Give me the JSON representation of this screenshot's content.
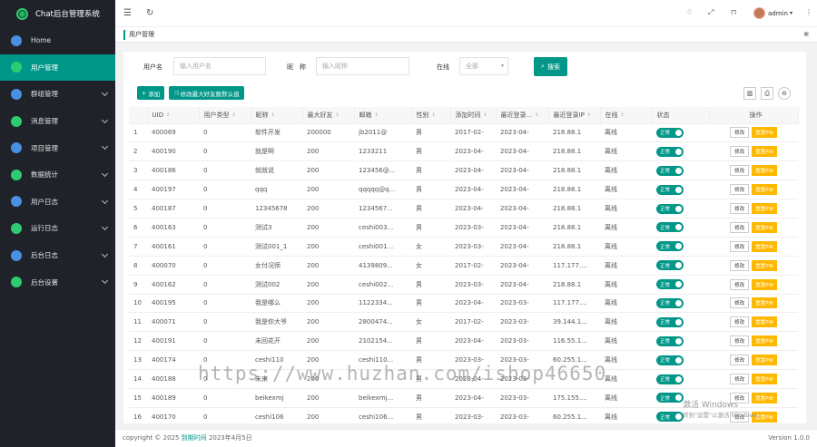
{
  "app": {
    "title": "Chat后台管理系统"
  },
  "sidebar": {
    "items": [
      {
        "label": "Home",
        "color": "#4a90e2",
        "active": false,
        "caret": false
      },
      {
        "label": "用户管理",
        "color": "#2ecc71",
        "active": true,
        "caret": false
      },
      {
        "label": "群组管理",
        "color": "#4a90e2",
        "active": false,
        "caret": true
      },
      {
        "label": "消息管理",
        "color": "#2ecc71",
        "active": false,
        "caret": true
      },
      {
        "label": "项目管理",
        "color": "#4a90e2",
        "active": false,
        "caret": true
      },
      {
        "label": "数据统计",
        "color": "#2ecc71",
        "active": false,
        "caret": true
      },
      {
        "label": "用户日志",
        "color": "#4a90e2",
        "active": false,
        "caret": true
      },
      {
        "label": "运行日志",
        "color": "#2ecc71",
        "active": false,
        "caret": true
      },
      {
        "label": "后台日志",
        "color": "#4a90e2",
        "active": false,
        "caret": true
      },
      {
        "label": "后台设置",
        "color": "#2ecc71",
        "active": false,
        "caret": true
      }
    ]
  },
  "topbar": {
    "user": "admin"
  },
  "tabs": {
    "current": "用户管理"
  },
  "search": {
    "user_label": "用户名",
    "user_placeholder": "输入用户名",
    "nick_label": "昵　称",
    "nick_placeholder": "输入昵称",
    "online_label": "在线",
    "online_value": "全部",
    "button": "搜索"
  },
  "toolbar": {
    "add": "添加",
    "batch": "修改最大好友数默认值"
  },
  "table": {
    "headers": [
      "",
      "UID",
      "用户类型",
      "昵称",
      "最大好友",
      "邮箱",
      "性别",
      "添加时间",
      "最近登录...",
      "最近登录IP",
      "在线",
      "状态",
      "操作"
    ],
    "status_label": "正常",
    "edit_label": "修改",
    "pwd_label": "重置PW",
    "rows": [
      [
        "1",
        "400069",
        "0",
        "软件开发",
        "200000",
        "jb2011@",
        "男",
        "2017-02-",
        "2023-04-",
        "218.88.1",
        "离线"
      ],
      [
        "2",
        "400190",
        "0",
        "就是啊",
        "200",
        "1233211",
        "男",
        "2023-04-",
        "2023-04-",
        "218.88.1",
        "离线"
      ],
      [
        "3",
        "400186",
        "0",
        "就就说",
        "200",
        "123456@...",
        "男",
        "2023-04-",
        "2023-04-",
        "218.88.1",
        "离线"
      ],
      [
        "4",
        "400197",
        "0",
        "qqq",
        "200",
        "qqqqq@q...",
        "男",
        "2023-04-",
        "2023-04-",
        "218.88.1",
        "离线"
      ],
      [
        "5",
        "400187",
        "0",
        "12345678",
        "200",
        "1234567...",
        "男",
        "2023-04-",
        "2023-04-",
        "218.88.1",
        "离线"
      ],
      [
        "6",
        "400163",
        "0",
        "测试3",
        "200",
        "ceshi003...",
        "男",
        "2023-03-",
        "2023-04-",
        "218.88.1",
        "离线"
      ],
      [
        "7",
        "400161",
        "0",
        "测试001_1",
        "200",
        "ceshi001...",
        "女",
        "2023-03-",
        "2023-04-",
        "218.88.1",
        "离线"
      ],
      [
        "8",
        "400070",
        "0",
        "女付况师",
        "200",
        "4139809...",
        "女",
        "2017-02-",
        "2023-04-",
        "117.177....",
        "离线"
      ],
      [
        "9",
        "400162",
        "0",
        "测试002",
        "200",
        "ceshi002...",
        "男",
        "2023-03-",
        "2023-04-",
        "218.88.1",
        "离线"
      ],
      [
        "10",
        "400195",
        "0",
        "我是哪么",
        "200",
        "1122334...",
        "男",
        "2023-04-",
        "2023-03-",
        "117.177....",
        "离线"
      ],
      [
        "11",
        "400071",
        "0",
        "我是你大爷",
        "200",
        "2800474...",
        "女",
        "2017-02-",
        "2023-03-",
        "39.144.1...",
        "离线"
      ],
      [
        "12",
        "400191",
        "0",
        "未回花开",
        "200",
        "2102154...",
        "男",
        "2023-04-",
        "2023-03-",
        "116.55.1...",
        "离线"
      ],
      [
        "13",
        "400174",
        "0",
        "ceshi110",
        "200",
        "ceshi110...",
        "男",
        "2023-03-",
        "2023-03-",
        "60.255.1...",
        "离线"
      ],
      [
        "14",
        "400188",
        "0",
        "未来",
        "200",
        "",
        "男",
        "2023-04-",
        "2023-03-",
        "",
        "离线"
      ],
      [
        "15",
        "400189",
        "0",
        "beikexmj",
        "200",
        "beikexmj...",
        "男",
        "2023-04-",
        "2023-03-",
        "175.155....",
        "离线"
      ],
      [
        "16",
        "400170",
        "0",
        "ceshi106",
        "200",
        "ceshi106...",
        "男",
        "2023-03-",
        "2023-03-",
        "60.255.1...",
        "离线"
      ]
    ]
  },
  "footer": {
    "copyright": "copyright © 2025",
    "link": "到期时间",
    "date": "2023年4月5日",
    "version": "Version 1.0.0"
  },
  "watermark": "https://www.huzhan.com/ishop46650",
  "windows_mark": {
    "line1": "激活 Windows",
    "line2": "转到\"设置\"以激活 Windows。"
  }
}
